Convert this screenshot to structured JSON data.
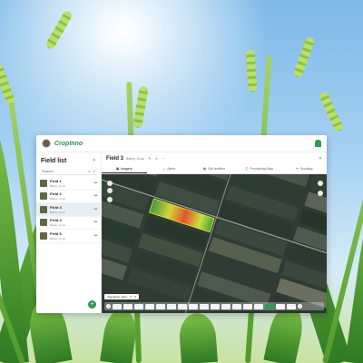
{
  "app": {
    "brand": "CropInno"
  },
  "sidebar": {
    "title": "Field list",
    "search_label": "Search",
    "fields": [
      {
        "name": "Field 1",
        "sub": "Barley, 11 ac",
        "selected": false
      },
      {
        "name": "Field 2",
        "sub": "Barley, 11 ac",
        "selected": false
      },
      {
        "name": "Field 3",
        "sub": "Barley, 11 ac",
        "selected": true
      },
      {
        "name": "Field 4",
        "sub": "Barley, 11 ac",
        "selected": false
      },
      {
        "name": "Field 5",
        "sub": "Barley, 11 ac",
        "selected": false
      }
    ]
  },
  "main": {
    "title": "Field 3",
    "subtitle": "Barley, 20 ac",
    "tabs": [
      {
        "label": "Imagery",
        "icon": "image-icon",
        "active": true
      },
      {
        "label": "Alerts",
        "icon": "alert-icon",
        "active": false
      },
      {
        "label": "Soil fertiliser",
        "icon": "grid-icon",
        "active": false
      },
      {
        "label": "Productivity Map",
        "icon": "map-icon",
        "active": false
      },
      {
        "label": "Scouting",
        "icon": "scout-icon",
        "active": false
      }
    ],
    "layer_select": "Vegetation Index"
  },
  "colors": {
    "accent": "#2e9b58",
    "map_dark": "#2d3a33"
  }
}
